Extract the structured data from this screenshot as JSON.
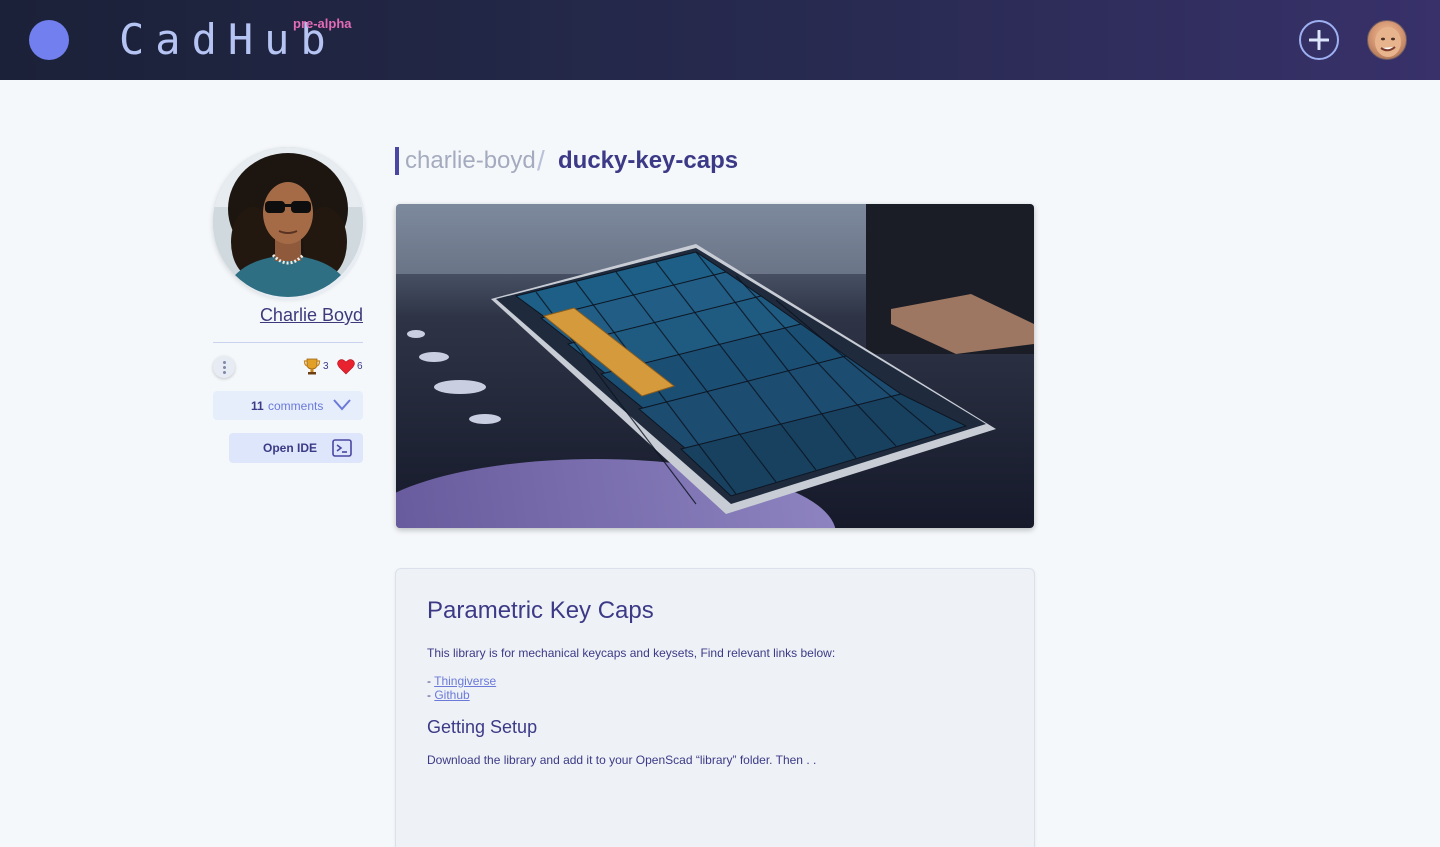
{
  "header": {
    "brand": "CadHub",
    "badge": "pre-alpha",
    "add_icon": "plus-circle-icon",
    "colors": {
      "gradient_start": "#1b2138",
      "gradient_end": "#38316a",
      "logo_dot": "#7180ee",
      "badge": "#e36bb7"
    }
  },
  "profile": {
    "name": "Charlie Boyd",
    "trophy_count": "3",
    "heart_count": "6",
    "comments_count": "11",
    "comments_label": "comments",
    "open_ide_label": "Open IDE",
    "menu_icon": "kebab-vertical-icon"
  },
  "breadcrumb": {
    "user": "charlie-boyd",
    "separator": "/",
    "part": "ducky-key-caps"
  },
  "description": {
    "title": "Parametric Key Caps",
    "intro": "This library is for mechanical keycaps and keysets, Find relevant links below:",
    "links": [
      {
        "prefix": "- ",
        "label": "Thingiverse"
      },
      {
        "prefix": "- ",
        "label": "Github"
      }
    ],
    "subheading": "Getting Setup",
    "setup_text": "Download the library and add it to your OpenScad “library” folder. Then . ."
  }
}
